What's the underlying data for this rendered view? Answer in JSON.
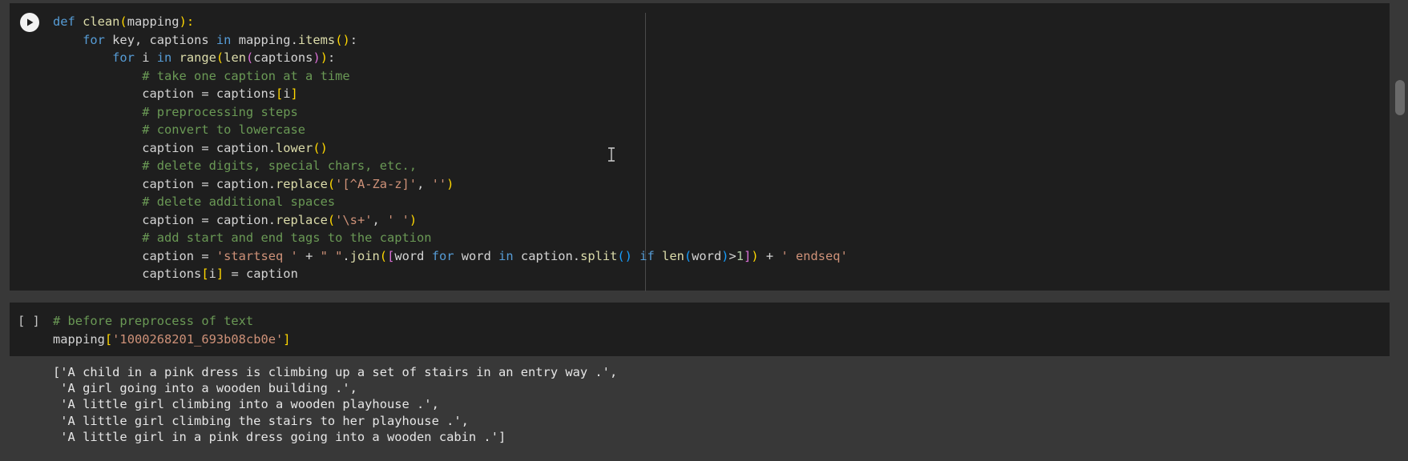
{
  "cell1": {
    "run_label": "Run cell",
    "lines": [
      [
        [
          "k",
          "def "
        ],
        [
          "f",
          "clean"
        ],
        [
          "b1",
          "("
        ],
        [
          "",
          "mapping"
        ],
        [
          "b1",
          "):"
        ]
      ],
      [
        [
          "",
          "    "
        ],
        [
          "k",
          "for "
        ],
        [
          "",
          "key, captions "
        ],
        [
          "k",
          "in "
        ],
        [
          "",
          "mapping."
        ],
        [
          "f",
          "items"
        ],
        [
          "b1",
          "()"
        ],
        [
          "",
          ":"
        ]
      ],
      [
        [
          "",
          "        "
        ],
        [
          "k",
          "for "
        ],
        [
          "",
          "i "
        ],
        [
          "k",
          "in "
        ],
        [
          "f",
          "range"
        ],
        [
          "b1",
          "("
        ],
        [
          "f",
          "len"
        ],
        [
          "b2",
          "("
        ],
        [
          "",
          "captions"
        ],
        [
          "b2",
          ")"
        ],
        [
          "b1",
          ")"
        ],
        [
          "",
          ":"
        ]
      ],
      [
        [
          "c",
          "            # take one caption at a time"
        ]
      ],
      [
        [
          "",
          "            caption = captions"
        ],
        [
          "b1",
          "["
        ],
        [
          "",
          "i"
        ],
        [
          "b1",
          "]"
        ]
      ],
      [
        [
          "c",
          "            # preprocessing steps"
        ]
      ],
      [
        [
          "c",
          "            # convert to lowercase"
        ]
      ],
      [
        [
          "",
          "            caption = caption."
        ],
        [
          "f",
          "lower"
        ],
        [
          "b1",
          "()"
        ]
      ],
      [
        [
          "c",
          "            # delete digits, special chars, etc.,"
        ]
      ],
      [
        [
          "",
          "            caption = caption."
        ],
        [
          "f",
          "replace"
        ],
        [
          "b1",
          "("
        ],
        [
          "s",
          "'[^A-Za-z]'"
        ],
        [
          "",
          ", "
        ],
        [
          "s",
          "''"
        ],
        [
          "b1",
          ")"
        ]
      ],
      [
        [
          "c",
          "            # delete additional spaces"
        ]
      ],
      [
        [
          "",
          "            caption = caption."
        ],
        [
          "f",
          "replace"
        ],
        [
          "b1",
          "("
        ],
        [
          "s",
          "'\\s+'"
        ],
        [
          "",
          ", "
        ],
        [
          "s",
          "' '"
        ],
        [
          "b1",
          ")"
        ]
      ],
      [
        [
          "c",
          "            # add start and end tags to the caption"
        ]
      ],
      [
        [
          "",
          "            caption = "
        ],
        [
          "s",
          "'startseq '"
        ],
        [
          "",
          " + "
        ],
        [
          "s",
          "\" \""
        ],
        [
          "",
          "."
        ],
        [
          "f",
          "join"
        ],
        [
          "b1",
          "("
        ],
        [
          "b2",
          "["
        ],
        [
          "",
          "word "
        ],
        [
          "k",
          "for "
        ],
        [
          "",
          "word "
        ],
        [
          "k",
          "in "
        ],
        [
          "",
          "caption."
        ],
        [
          "f",
          "split"
        ],
        [
          "b3",
          "()"
        ],
        [
          "",
          " "
        ],
        [
          "k",
          "if "
        ],
        [
          "f",
          "len"
        ],
        [
          "b3",
          "("
        ],
        [
          "",
          "word"
        ],
        [
          "b3",
          ")"
        ],
        [
          "",
          ">"
        ],
        [
          "n",
          "1"
        ],
        [
          "b2",
          "]"
        ],
        [
          "b1",
          ")"
        ],
        [
          "",
          " + "
        ],
        [
          "s",
          "' endseq'"
        ]
      ],
      [
        [
          "",
          "            captions"
        ],
        [
          "b1",
          "["
        ],
        [
          "",
          "i"
        ],
        [
          "b1",
          "]"
        ],
        [
          "",
          " = caption"
        ]
      ]
    ]
  },
  "cell2": {
    "exec_count": "[ ]",
    "lines": [
      [
        [
          "c",
          "# before preprocess of text"
        ]
      ],
      [
        [
          "",
          "mapping"
        ],
        [
          "b1",
          "["
        ],
        [
          "s",
          "'1000268201_693b08cb0e'"
        ],
        [
          "b1",
          "]"
        ]
      ]
    ]
  },
  "output": {
    "lines": [
      "['A child in a pink dress is climbing up a set of stairs in an entry way .',",
      " 'A girl going into a wooden building .',",
      " 'A little girl climbing into a wooden playhouse .',",
      " 'A little girl climbing the stairs to her playhouse .',",
      " 'A little girl in a pink dress going into a wooden cabin .']"
    ]
  },
  "colors": {
    "cell_bg": "#1e1e1e",
    "page_bg": "#383838",
    "keyword": "#569cd6",
    "comment": "#6a9955",
    "string": "#ce9178",
    "function": "#dcdcaa"
  }
}
